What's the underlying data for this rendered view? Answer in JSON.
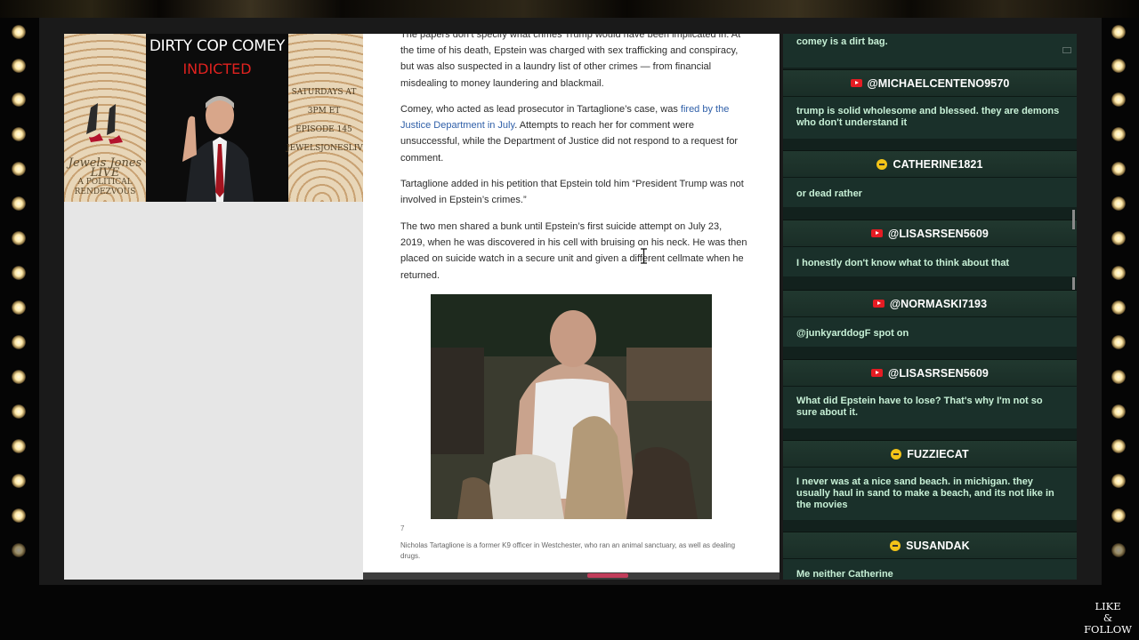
{
  "banner": {
    "title": "DIRTY COP COMEY",
    "subtitle": "INDICTED",
    "logo_line1": "Jewels Jones",
    "logo_line2": "LIVE",
    "logo_line3": "A POLITICAL RENDEZVOUS",
    "schedule_1": "SATURDAYS AT 3PM ET",
    "schedule_2": "EPISODE 145",
    "schedule_3": "JEWELSJONESLIVE.COM"
  },
  "article": {
    "p1": "The papers don’t specify what crimes Trump would have been implicated in. At the time of his death, Epstein was charged with sex trafficking and conspiracy, but was also suspected in a laundry list of other crimes — from financial misdealing to money laundering and blackmail.",
    "p2_before": "Comey, who acted as lead prosecutor in Tartaglione’s case, was ",
    "p2_link": "fired by the Justice Department in July",
    "p2_after": ". Attempts to reach her for comment were unsuccessful, while the Department of Justice did not respond to a request for comment.",
    "p3": "Tartaglione added in his petition that Epstein told him “President Trump was not involved in Epstein’s crimes.”",
    "p4": "The two men shared a bunk until Epstein’s first suicide attempt on July 23, 2019, when he was discovered in his cell with bruising on his neck. He was then placed on suicide watch in a secure unit and given a different cellmate when he returned.",
    "photo_number": "7",
    "caption": "Nicholas Tartaglione is a former K9 officer in Westchester, who ran an animal sanctuary, as well as dealing drugs."
  },
  "chat": {
    "top_message": "comey is a dirt bag.",
    "messages": [
      {
        "name": "@MICHAELCENTENO9570",
        "platform": "youtube",
        "text": "trump is solid wholesome and blessed. they are demons who don't understand it"
      },
      {
        "name": "CATHERINE1821",
        "platform": "twitch",
        "text": "or dead rather"
      },
      {
        "name": "@LISASRSEN5609",
        "platform": "youtube",
        "text": "I honestly don't know what to think about that"
      },
      {
        "name": "@NORMASKI7193",
        "platform": "youtube",
        "text": "@junkyarddogF spot on"
      },
      {
        "name": "@LISASRSEN5609",
        "platform": "youtube",
        "text": "What did Epstein have to lose? That's why I'm not so sure about it."
      },
      {
        "name": "FUZZIECAT",
        "platform": "twitch",
        "text": "I never was at a nice sand beach. in michigan. they usually haul in sand to make a beach, and its not like in the movies"
      },
      {
        "name": "SUSANDAK",
        "platform": "twitch",
        "text": "Me neither Catherine"
      }
    ]
  },
  "overlay": {
    "like_line1": "LIKE",
    "like_line2": "&",
    "like_line3": "FOLLOW"
  }
}
